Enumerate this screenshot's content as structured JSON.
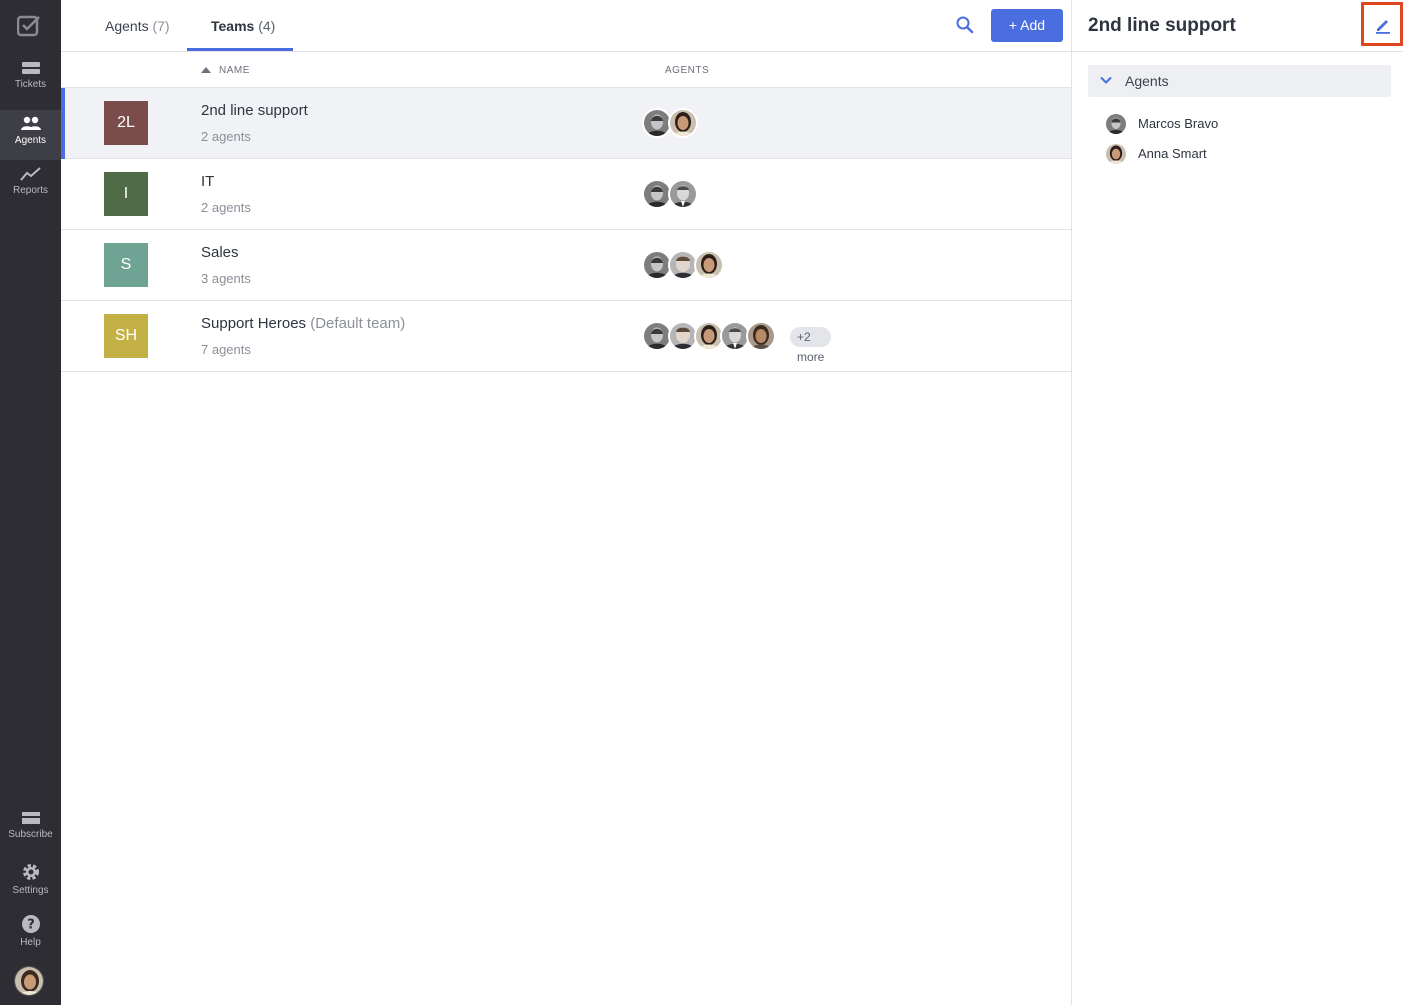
{
  "sidebar": {
    "items": [
      {
        "label": "Tickets",
        "icon": "ticket-icon"
      },
      {
        "label": "Agents",
        "icon": "agents-icon",
        "active": true
      },
      {
        "label": "Reports",
        "icon": "reports-icon"
      },
      {
        "label": "Subscribe",
        "icon": "card-icon"
      },
      {
        "label": "Settings",
        "icon": "gear-icon"
      },
      {
        "label": "Help",
        "icon": "help-icon"
      }
    ]
  },
  "header": {
    "tabs": [
      {
        "label": "Agents",
        "count": "(7)"
      },
      {
        "label": "Teams",
        "count": "(4)",
        "active": true
      }
    ],
    "add_label": "+ Add"
  },
  "columns": {
    "name": "NAME",
    "agents": "AGENTS"
  },
  "teams": [
    {
      "initials": "2L",
      "name": "2nd line support",
      "suffix": "",
      "count": "2 agents",
      "color": "#7a4d4a",
      "selected": true
    },
    {
      "initials": "I",
      "name": "IT",
      "suffix": "",
      "count": "2 agents",
      "color": "#4e6b45"
    },
    {
      "initials": "S",
      "name": "Sales",
      "suffix": "",
      "count": "3 agents",
      "color": "#6fa393"
    },
    {
      "initials": "SH",
      "name": "Support Heroes",
      "suffix": "(Default team)",
      "count": "7 agents",
      "color": "#c4b146",
      "more": "+2 more"
    }
  ],
  "panel": {
    "title": "2nd line support",
    "section_label": "Agents",
    "agents": [
      "Marcos Bravo",
      "Anna Smart"
    ]
  },
  "colors": {
    "accent": "#4a6ee0",
    "highlight": "#e3461f",
    "sidebar_bg": "#2d2d33"
  }
}
